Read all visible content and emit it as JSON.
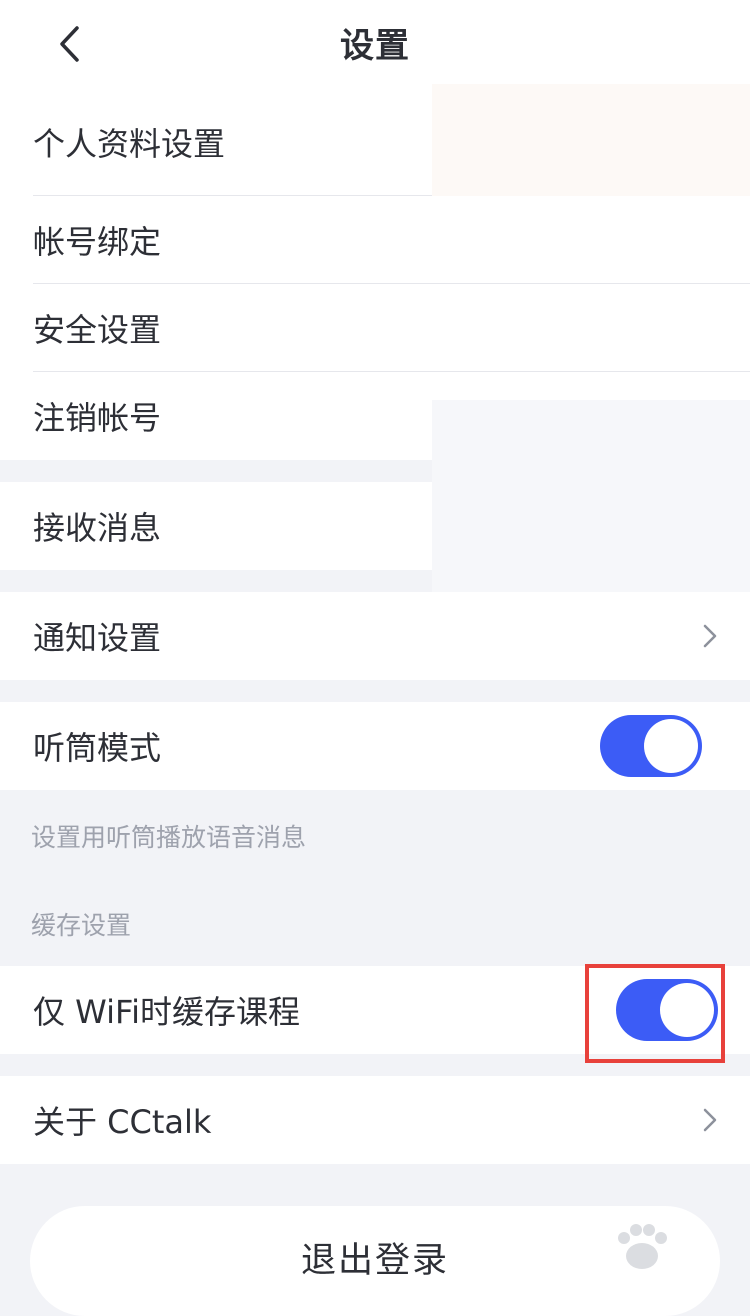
{
  "header": {
    "title": "设置",
    "back_icon": "chevron-left-icon"
  },
  "account_section": {
    "items": [
      {
        "label": "个人资料设置"
      },
      {
        "label": "帐号绑定"
      },
      {
        "label": "安全设置"
      },
      {
        "label": "注销帐号"
      }
    ]
  },
  "receive_messages": {
    "label": "接收消息"
  },
  "notification_settings": {
    "label": "通知设置",
    "icon": "chevron-right-icon"
  },
  "earpiece_mode": {
    "label": "听筒模式",
    "enabled": true,
    "hint": "设置用听筒播放语音消息"
  },
  "cache_section": {
    "header": "缓存设置",
    "wifi_only": {
      "label": "仅 WiFi时缓存课程",
      "enabled": true
    }
  },
  "about": {
    "label": "关于 CCtalk",
    "icon": "chevron-right-icon"
  },
  "logout": {
    "label": "退出登录"
  },
  "colors": {
    "toggle_on": "#3c5cf6",
    "highlight_border": "#e8413b",
    "background": "#f2f3f7"
  }
}
